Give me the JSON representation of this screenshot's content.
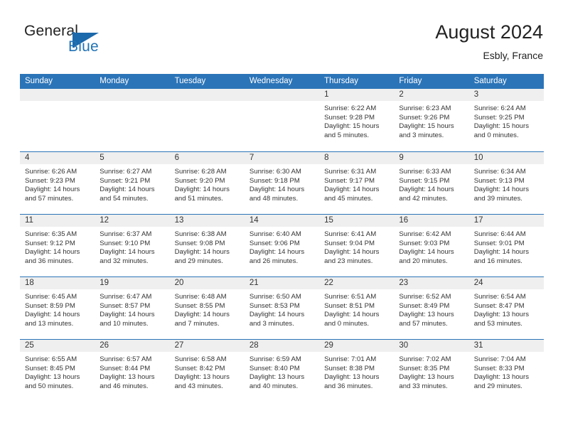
{
  "brand": {
    "word1": "General",
    "word2": "Blue",
    "mark_icon": "general-blue-flag-logo",
    "accent_color": "#1c69ab"
  },
  "header": {
    "title": "August 2024",
    "location": "Esbly, France"
  },
  "theme": {
    "header_blue": "#2b74b8",
    "daynum_strip": "#efefef",
    "text": "#333333"
  },
  "calendar": {
    "weekday_headers": [
      "Sunday",
      "Monday",
      "Tuesday",
      "Wednesday",
      "Thursday",
      "Friday",
      "Saturday"
    ],
    "weeks": [
      [
        {
          "day": "",
          "empty": true
        },
        {
          "day": "",
          "empty": true
        },
        {
          "day": "",
          "empty": true
        },
        {
          "day": "",
          "empty": true
        },
        {
          "day": "1",
          "sunrise": "Sunrise: 6:22 AM",
          "sunset": "Sunset: 9:28 PM",
          "daylight1": "Daylight: 15 hours",
          "daylight2": "and 5 minutes."
        },
        {
          "day": "2",
          "sunrise": "Sunrise: 6:23 AM",
          "sunset": "Sunset: 9:26 PM",
          "daylight1": "Daylight: 15 hours",
          "daylight2": "and 3 minutes."
        },
        {
          "day": "3",
          "sunrise": "Sunrise: 6:24 AM",
          "sunset": "Sunset: 9:25 PM",
          "daylight1": "Daylight: 15 hours",
          "daylight2": "and 0 minutes."
        }
      ],
      [
        {
          "day": "4",
          "sunrise": "Sunrise: 6:26 AM",
          "sunset": "Sunset: 9:23 PM",
          "daylight1": "Daylight: 14 hours",
          "daylight2": "and 57 minutes."
        },
        {
          "day": "5",
          "sunrise": "Sunrise: 6:27 AM",
          "sunset": "Sunset: 9:21 PM",
          "daylight1": "Daylight: 14 hours",
          "daylight2": "and 54 minutes."
        },
        {
          "day": "6",
          "sunrise": "Sunrise: 6:28 AM",
          "sunset": "Sunset: 9:20 PM",
          "daylight1": "Daylight: 14 hours",
          "daylight2": "and 51 minutes."
        },
        {
          "day": "7",
          "sunrise": "Sunrise: 6:30 AM",
          "sunset": "Sunset: 9:18 PM",
          "daylight1": "Daylight: 14 hours",
          "daylight2": "and 48 minutes."
        },
        {
          "day": "8",
          "sunrise": "Sunrise: 6:31 AM",
          "sunset": "Sunset: 9:17 PM",
          "daylight1": "Daylight: 14 hours",
          "daylight2": "and 45 minutes."
        },
        {
          "day": "9",
          "sunrise": "Sunrise: 6:33 AM",
          "sunset": "Sunset: 9:15 PM",
          "daylight1": "Daylight: 14 hours",
          "daylight2": "and 42 minutes."
        },
        {
          "day": "10",
          "sunrise": "Sunrise: 6:34 AM",
          "sunset": "Sunset: 9:13 PM",
          "daylight1": "Daylight: 14 hours",
          "daylight2": "and 39 minutes."
        }
      ],
      [
        {
          "day": "11",
          "sunrise": "Sunrise: 6:35 AM",
          "sunset": "Sunset: 9:12 PM",
          "daylight1": "Daylight: 14 hours",
          "daylight2": "and 36 minutes."
        },
        {
          "day": "12",
          "sunrise": "Sunrise: 6:37 AM",
          "sunset": "Sunset: 9:10 PM",
          "daylight1": "Daylight: 14 hours",
          "daylight2": "and 32 minutes."
        },
        {
          "day": "13",
          "sunrise": "Sunrise: 6:38 AM",
          "sunset": "Sunset: 9:08 PM",
          "daylight1": "Daylight: 14 hours",
          "daylight2": "and 29 minutes."
        },
        {
          "day": "14",
          "sunrise": "Sunrise: 6:40 AM",
          "sunset": "Sunset: 9:06 PM",
          "daylight1": "Daylight: 14 hours",
          "daylight2": "and 26 minutes."
        },
        {
          "day": "15",
          "sunrise": "Sunrise: 6:41 AM",
          "sunset": "Sunset: 9:04 PM",
          "daylight1": "Daylight: 14 hours",
          "daylight2": "and 23 minutes."
        },
        {
          "day": "16",
          "sunrise": "Sunrise: 6:42 AM",
          "sunset": "Sunset: 9:03 PM",
          "daylight1": "Daylight: 14 hours",
          "daylight2": "and 20 minutes."
        },
        {
          "day": "17",
          "sunrise": "Sunrise: 6:44 AM",
          "sunset": "Sunset: 9:01 PM",
          "daylight1": "Daylight: 14 hours",
          "daylight2": "and 16 minutes."
        }
      ],
      [
        {
          "day": "18",
          "sunrise": "Sunrise: 6:45 AM",
          "sunset": "Sunset: 8:59 PM",
          "daylight1": "Daylight: 14 hours",
          "daylight2": "and 13 minutes."
        },
        {
          "day": "19",
          "sunrise": "Sunrise: 6:47 AM",
          "sunset": "Sunset: 8:57 PM",
          "daylight1": "Daylight: 14 hours",
          "daylight2": "and 10 minutes."
        },
        {
          "day": "20",
          "sunrise": "Sunrise: 6:48 AM",
          "sunset": "Sunset: 8:55 PM",
          "daylight1": "Daylight: 14 hours",
          "daylight2": "and 7 minutes."
        },
        {
          "day": "21",
          "sunrise": "Sunrise: 6:50 AM",
          "sunset": "Sunset: 8:53 PM",
          "daylight1": "Daylight: 14 hours",
          "daylight2": "and 3 minutes."
        },
        {
          "day": "22",
          "sunrise": "Sunrise: 6:51 AM",
          "sunset": "Sunset: 8:51 PM",
          "daylight1": "Daylight: 14 hours",
          "daylight2": "and 0 minutes."
        },
        {
          "day": "23",
          "sunrise": "Sunrise: 6:52 AM",
          "sunset": "Sunset: 8:49 PM",
          "daylight1": "Daylight: 13 hours",
          "daylight2": "and 57 minutes."
        },
        {
          "day": "24",
          "sunrise": "Sunrise: 6:54 AM",
          "sunset": "Sunset: 8:47 PM",
          "daylight1": "Daylight: 13 hours",
          "daylight2": "and 53 minutes."
        }
      ],
      [
        {
          "day": "25",
          "sunrise": "Sunrise: 6:55 AM",
          "sunset": "Sunset: 8:45 PM",
          "daylight1": "Daylight: 13 hours",
          "daylight2": "and 50 minutes."
        },
        {
          "day": "26",
          "sunrise": "Sunrise: 6:57 AM",
          "sunset": "Sunset: 8:44 PM",
          "daylight1": "Daylight: 13 hours",
          "daylight2": "and 46 minutes."
        },
        {
          "day": "27",
          "sunrise": "Sunrise: 6:58 AM",
          "sunset": "Sunset: 8:42 PM",
          "daylight1": "Daylight: 13 hours",
          "daylight2": "and 43 minutes."
        },
        {
          "day": "28",
          "sunrise": "Sunrise: 6:59 AM",
          "sunset": "Sunset: 8:40 PM",
          "daylight1": "Daylight: 13 hours",
          "daylight2": "and 40 minutes."
        },
        {
          "day": "29",
          "sunrise": "Sunrise: 7:01 AM",
          "sunset": "Sunset: 8:38 PM",
          "daylight1": "Daylight: 13 hours",
          "daylight2": "and 36 minutes."
        },
        {
          "day": "30",
          "sunrise": "Sunrise: 7:02 AM",
          "sunset": "Sunset: 8:35 PM",
          "daylight1": "Daylight: 13 hours",
          "daylight2": "and 33 minutes."
        },
        {
          "day": "31",
          "sunrise": "Sunrise: 7:04 AM",
          "sunset": "Sunset: 8:33 PM",
          "daylight1": "Daylight: 13 hours",
          "daylight2": "and 29 minutes."
        }
      ]
    ]
  }
}
